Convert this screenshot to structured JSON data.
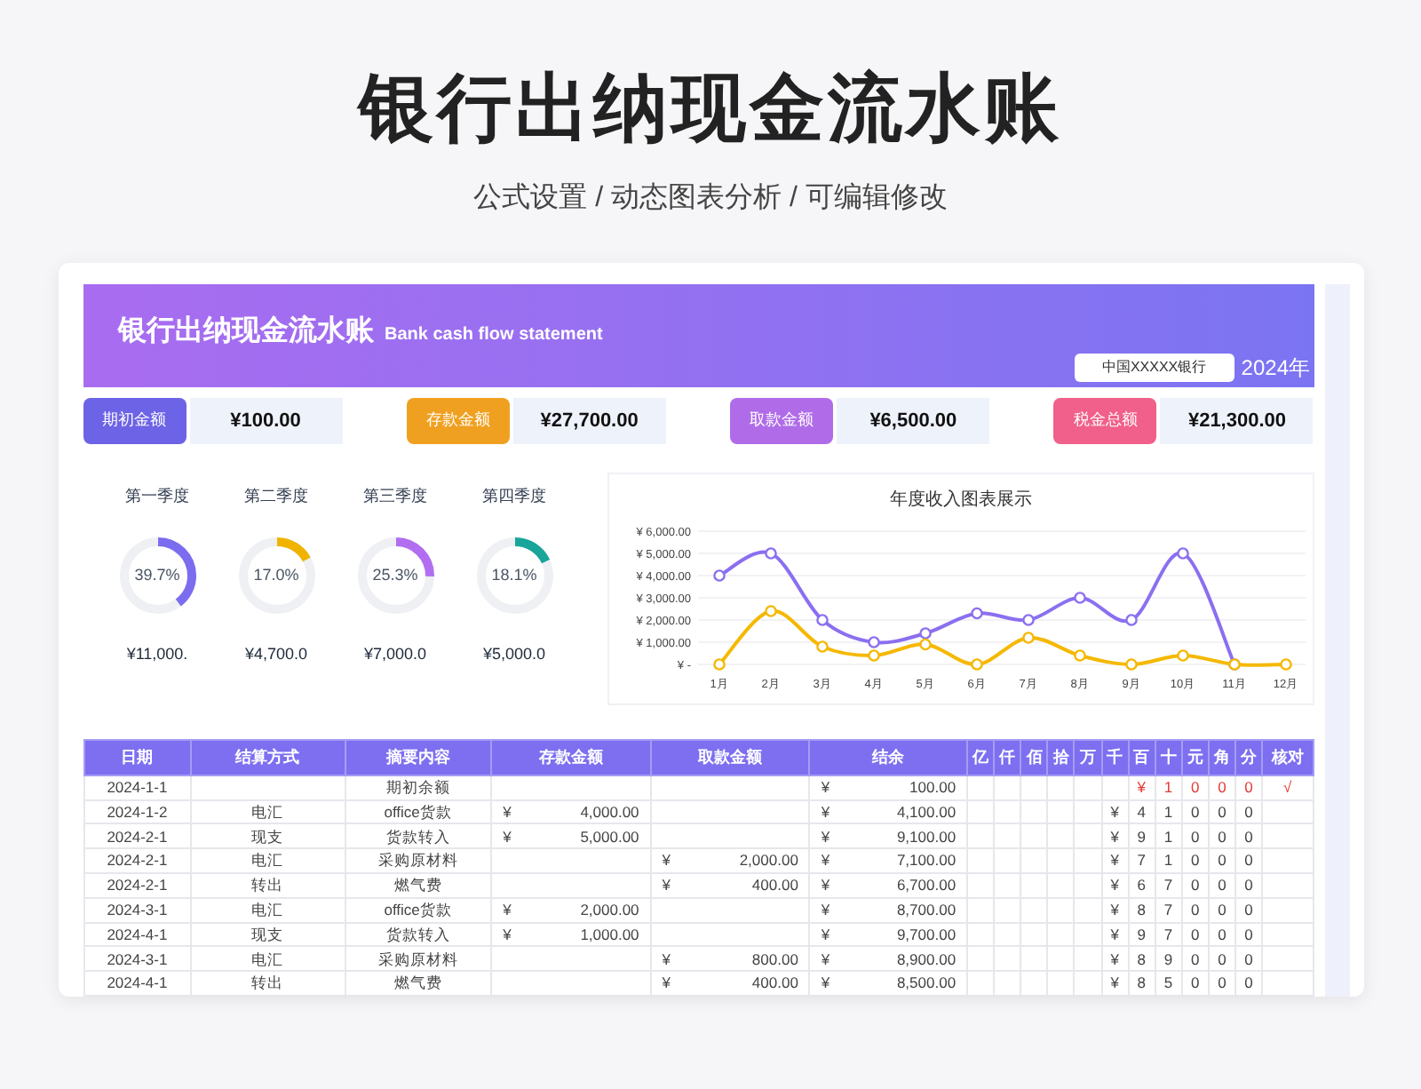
{
  "title": "银行出纳现金流水账",
  "subtitle": "公式设置 / 动态图表分析 / 可编辑修改",
  "banner": {
    "title": "银行出纳现金流水账",
    "subtitle": "Bank cash flow statement",
    "bank": "中国XXXXX银行",
    "year": "2024年"
  },
  "summary": [
    {
      "label": "期初金额",
      "value": "¥100.00",
      "color": "#6d63e6"
    },
    {
      "label": "存款金额",
      "value": "¥27,700.00",
      "color": "#f0a020"
    },
    {
      "label": "取款金额",
      "value": "¥6,500.00",
      "color": "#b06ce8"
    },
    {
      "label": "税金总额",
      "value": "¥21,300.00",
      "color": "#f0608a"
    }
  ],
  "quarters": [
    {
      "label": "第一季度",
      "percent": "39.7%",
      "level": 0.397,
      "amount": "¥11,000.",
      "color": "#7b6cf0"
    },
    {
      "label": "第二季度",
      "percent": "17.0%",
      "level": 0.17,
      "amount": "¥4,700.0",
      "color": "#f0b400"
    },
    {
      "label": "第三季度",
      "percent": "25.3%",
      "level": 0.253,
      "amount": "¥7,000.0",
      "color": "#b26ef0"
    },
    {
      "label": "第四季度",
      "percent": "18.1%",
      "level": 0.181,
      "amount": "¥5,000.0",
      "color": "#1aa59a"
    }
  ],
  "chart": {
    "chart_data": {
      "type": "line",
      "title": "年度收入图表展示",
      "categories": [
        "1月",
        "2月",
        "3月",
        "4月",
        "5月",
        "6月",
        "7月",
        "8月",
        "9月",
        "10月",
        "11月",
        "12月"
      ],
      "grid": true,
      "series": [
        {
          "marker": "circle",
          "color": "#8b6ff0",
          "values": [
            4000,
            5000,
            2000,
            1000,
            1400,
            2300,
            2000,
            3000,
            2000,
            5000,
            0,
            null
          ]
        },
        {
          "marker": "circle",
          "color": "#f5b800",
          "values": [
            0,
            2400,
            800,
            400,
            900,
            0,
            1200,
            400,
            0,
            400,
            0,
            0
          ]
        }
      ],
      "ylim": [
        0,
        6000
      ],
      "yticks": [
        {
          "value": 0,
          "label": "¥ -"
        },
        {
          "value": 1000,
          "label": "¥ 1,000.00"
        },
        {
          "value": 2000,
          "label": "¥ 2,000.00"
        },
        {
          "value": 3000,
          "label": "¥ 3,000.00"
        },
        {
          "value": 4000,
          "label": "¥ 4,000.00"
        },
        {
          "value": 5000,
          "label": "¥ 5,000.00"
        },
        {
          "value": 6000,
          "label": "¥ 6,000.00"
        }
      ]
    }
  },
  "table": {
    "columns": [
      "日期",
      "结算方式",
      "摘要内容",
      "存款金额",
      "取款金额",
      "结余",
      "亿",
      "仟",
      "佰",
      "拾",
      "万",
      "千",
      "百",
      "十",
      "元",
      "角",
      "分",
      "核对"
    ],
    "rows": [
      {
        "date": "2024-1-1",
        "summary": "期初余额",
        "balance": {
          "symbol": "¥",
          "amount": "100.00"
        },
        "digits": [
          "¥",
          "1",
          "0",
          "0",
          "0"
        ],
        "highlighted": true,
        "check": "√"
      },
      {
        "date": "2024-1-2",
        "method": "电汇",
        "summary": "office货款",
        "deposit": {
          "symbol": "¥",
          "amount": "4,000.00"
        },
        "balance": {
          "symbol": "¥",
          "amount": "4,100.00"
        },
        "digits": [
          "¥",
          "4",
          "1",
          "0",
          "0",
          "0"
        ],
        "highlighted": false
      },
      {
        "date": "2024-2-1",
        "method": "现支",
        "summary": "货款转入",
        "deposit": {
          "symbol": "¥",
          "amount": "5,000.00"
        },
        "balance": {
          "symbol": "¥",
          "amount": "9,100.00"
        },
        "digits": [
          "¥",
          "9",
          "1",
          "0",
          "0",
          "0"
        ],
        "highlighted": false
      },
      {
        "date": "2024-2-1",
        "method": "电汇",
        "summary": "采购原材料",
        "withdraw": {
          "symbol": "¥",
          "amount": "2,000.00"
        },
        "balance": {
          "symbol": "¥",
          "amount": "7,100.00"
        },
        "digits": [
          "¥",
          "7",
          "1",
          "0",
          "0",
          "0"
        ],
        "highlighted": false
      },
      {
        "date": "2024-2-1",
        "method": "转出",
        "summary": "燃气费",
        "withdraw": {
          "symbol": "¥",
          "amount": "400.00"
        },
        "balance": {
          "symbol": "¥",
          "amount": "6,700.00"
        },
        "digits": [
          "¥",
          "6",
          "7",
          "0",
          "0",
          "0"
        ],
        "highlighted": false
      },
      {
        "date": "2024-3-1",
        "method": "电汇",
        "summary": "office货款",
        "deposit": {
          "symbol": "¥",
          "amount": "2,000.00"
        },
        "balance": {
          "symbol": "¥",
          "amount": "8,700.00"
        },
        "digits": [
          "¥",
          "8",
          "7",
          "0",
          "0",
          "0"
        ],
        "highlighted": false
      },
      {
        "date": "2024-4-1",
        "method": "现支",
        "summary": "货款转入",
        "deposit": {
          "symbol": "¥",
          "amount": "1,000.00"
        },
        "balance": {
          "symbol": "¥",
          "amount": "9,700.00"
        },
        "digits": [
          "¥",
          "9",
          "7",
          "0",
          "0",
          "0"
        ],
        "highlighted": false
      },
      {
        "date": "2024-3-1",
        "method": "电汇",
        "summary": "采购原材料",
        "withdraw": {
          "symbol": "¥",
          "amount": "800.00"
        },
        "balance": {
          "symbol": "¥",
          "amount": "8,900.00"
        },
        "digits": [
          "¥",
          "8",
          "9",
          "0",
          "0",
          "0"
        ],
        "highlighted": false
      },
      {
        "date": "2024-4-1",
        "method": "转出",
        "summary": "燃气费",
        "withdraw": {
          "symbol": "¥",
          "amount": "400.00"
        },
        "balance": {
          "symbol": "¥",
          "amount": "8,500.00"
        },
        "digits": [
          "¥",
          "8",
          "5",
          "0",
          "0",
          "0"
        ],
        "highlighted": false
      }
    ]
  }
}
